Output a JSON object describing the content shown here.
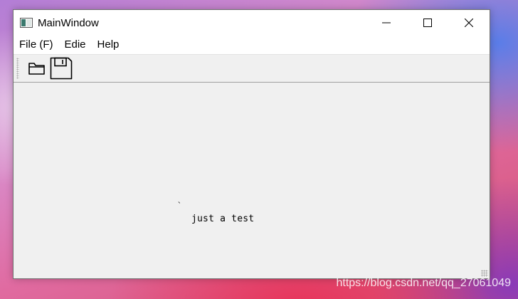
{
  "window": {
    "title": "MainWindow",
    "controls": {
      "minimize_icon": "minimize-icon",
      "maximize_icon": "maximize-icon",
      "close_icon": "close-icon"
    }
  },
  "menubar": {
    "items": [
      "File (F)",
      "Edie",
      "Help"
    ]
  },
  "toolbar": {
    "buttons": [
      {
        "icon": "folder-open-icon"
      },
      {
        "icon": "save-icon"
      }
    ]
  },
  "central": {
    "tick": "`",
    "label": "just a test"
  },
  "watermark": "https://blog.csdn.net/qq_27061049"
}
